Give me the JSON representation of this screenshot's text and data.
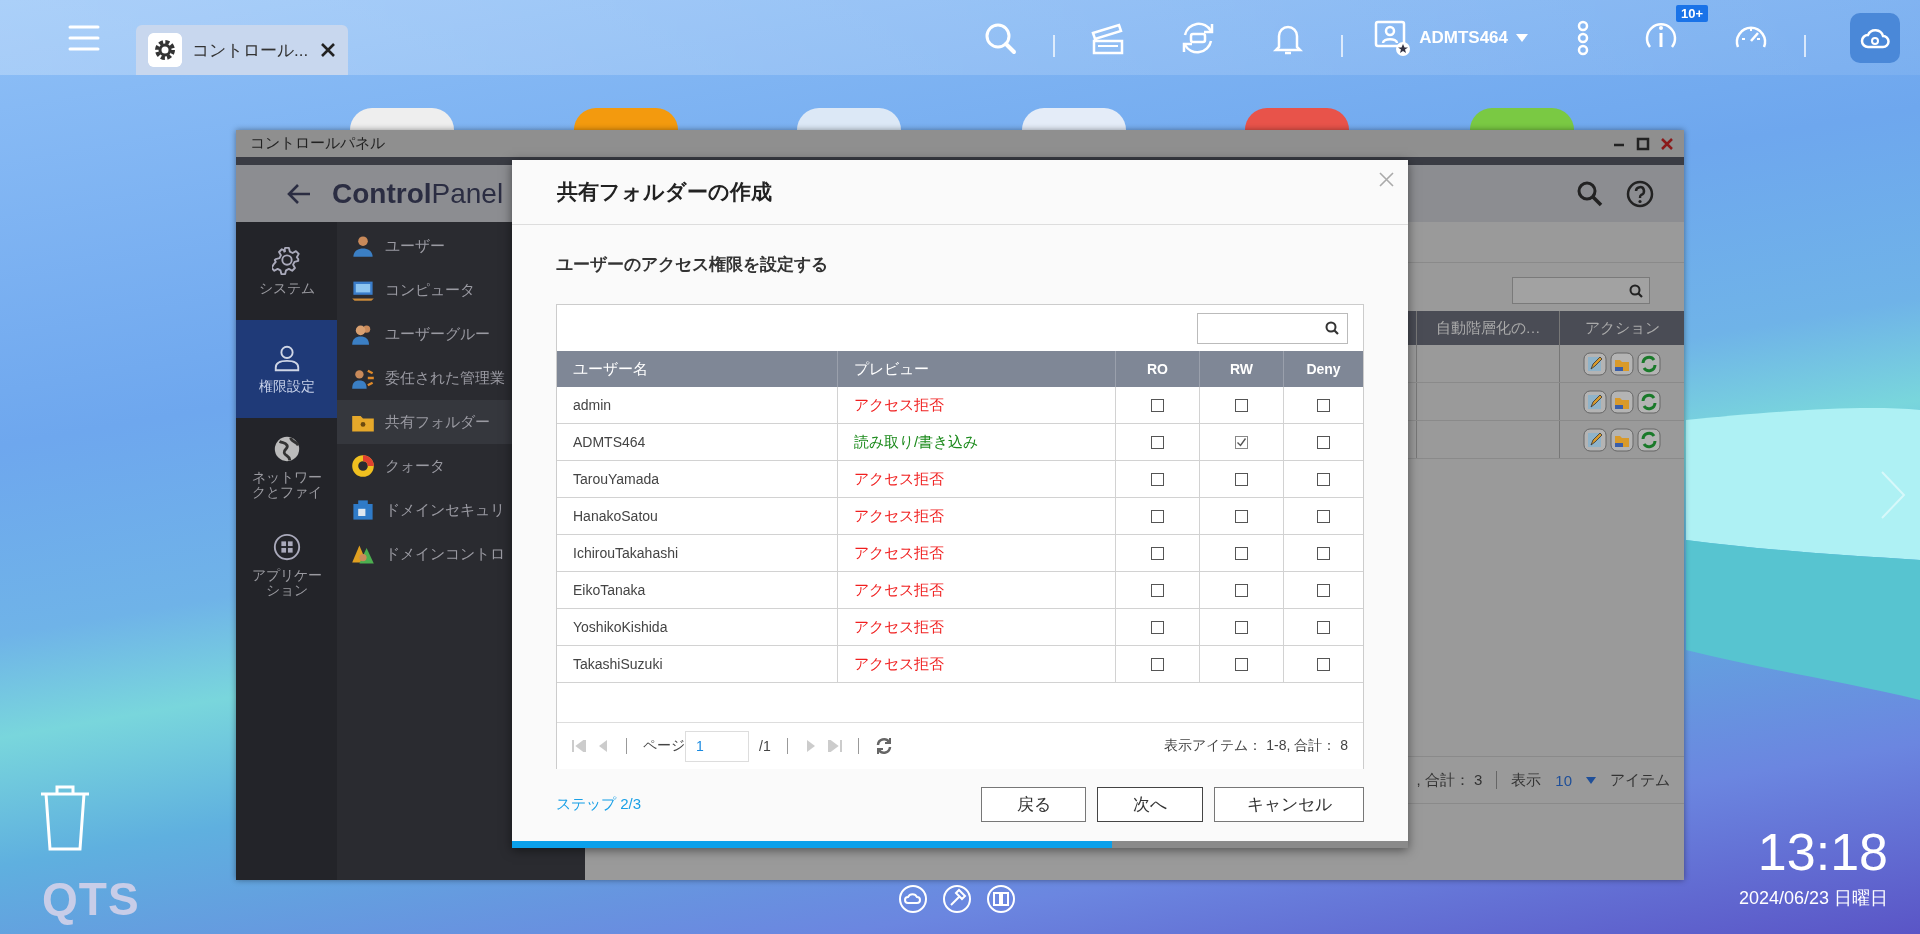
{
  "taskbar": {
    "tab": {
      "label": "コントロール..."
    },
    "user": "ADMTS464",
    "badge": "10+"
  },
  "desktop_icons": [
    {
      "color": "#eeeeee"
    },
    {
      "color": "#f39a0e"
    },
    {
      "color": "#dce8f6"
    },
    {
      "color": "#e4ecf8"
    },
    {
      "color": "#e8534a"
    },
    {
      "color": "#7ac943"
    }
  ],
  "window": {
    "title": "コントロールパネル",
    "app_name": "**Control**Panel",
    "nav": [
      {
        "label": "システム",
        "selected": false
      },
      {
        "label": "権限設定",
        "selected": true
      },
      {
        "label": "ネットワークとファイ",
        "selected": false
      },
      {
        "label": "アプリケーション",
        "selected": false
      }
    ],
    "menu": [
      {
        "label": "ユーザー",
        "selected": false
      },
      {
        "label": "コンピュータ",
        "selected": false
      },
      {
        "label": "ユーザーグルー",
        "selected": false
      },
      {
        "label": "委任された管理業",
        "selected": false
      },
      {
        "label": "共有フォルダー",
        "selected": true
      },
      {
        "label": "クォータ",
        "selected": false
      },
      {
        "label": "ドメインセキュリ",
        "selected": false
      },
      {
        "label": "ドメインコントロ",
        "selected": false
      }
    ],
    "table": {
      "columns": [
        "自動階層化の…",
        "アクション"
      ],
      "rows": [
        {
          "selected": false
        },
        {
          "selected": false
        },
        {
          "selected": false
        }
      ]
    },
    "footer": {
      "summary": ", 合計： 3",
      "show": "表示",
      "page_size": "10",
      "unit": "アイテム"
    }
  },
  "dialog": {
    "title": "共有フォルダーの作成",
    "heading": "ユーザーのアクセス権限を設定する",
    "columns": [
      "ユーザー名",
      "プレビュー",
      "RO",
      "RW",
      "Deny"
    ],
    "rows": [
      {
        "name": "admin",
        "preview": "アクセス拒否",
        "kind": "deny",
        "ro": false,
        "rw": false,
        "deny": false
      },
      {
        "name": "ADMTS464",
        "preview": "読み取り/書き込み",
        "kind": "read_write",
        "ro": false,
        "rw": true,
        "deny": false
      },
      {
        "name": "TarouYamada",
        "preview": "アクセス拒否",
        "kind": "deny",
        "ro": false,
        "rw": false,
        "deny": false
      },
      {
        "name": "HanakoSatou",
        "preview": "アクセス拒否",
        "kind": "deny",
        "ro": false,
        "rw": false,
        "deny": false
      },
      {
        "name": "IchirouTakahashi",
        "preview": "アクセス拒否",
        "kind": "deny",
        "ro": false,
        "rw": false,
        "deny": false
      },
      {
        "name": "EikoTanaka",
        "preview": "アクセス拒否",
        "kind": "deny",
        "ro": false,
        "rw": false,
        "deny": false
      },
      {
        "name": "YoshikoKishida",
        "preview": "アクセス拒否",
        "kind": "deny",
        "ro": false,
        "rw": false,
        "deny": false
      },
      {
        "name": "TakashiSuzuki",
        "preview": "アクセス拒否",
        "kind": "deny",
        "ro": false,
        "rw": false,
        "deny": false
      }
    ],
    "pager": {
      "label": "ページ",
      "page": "1",
      "total": "/1",
      "summary": "表示アイテム： 1-8, 合計： 8"
    },
    "step": "ステップ 2/3",
    "buttons": [
      "戻る",
      "次へ",
      "キャンセル"
    ],
    "progress": {
      "level": 0.67
    }
  },
  "desktop": {
    "logo": "QTS",
    "time": "13:18",
    "date": "2024/06/23 日曜日"
  }
}
